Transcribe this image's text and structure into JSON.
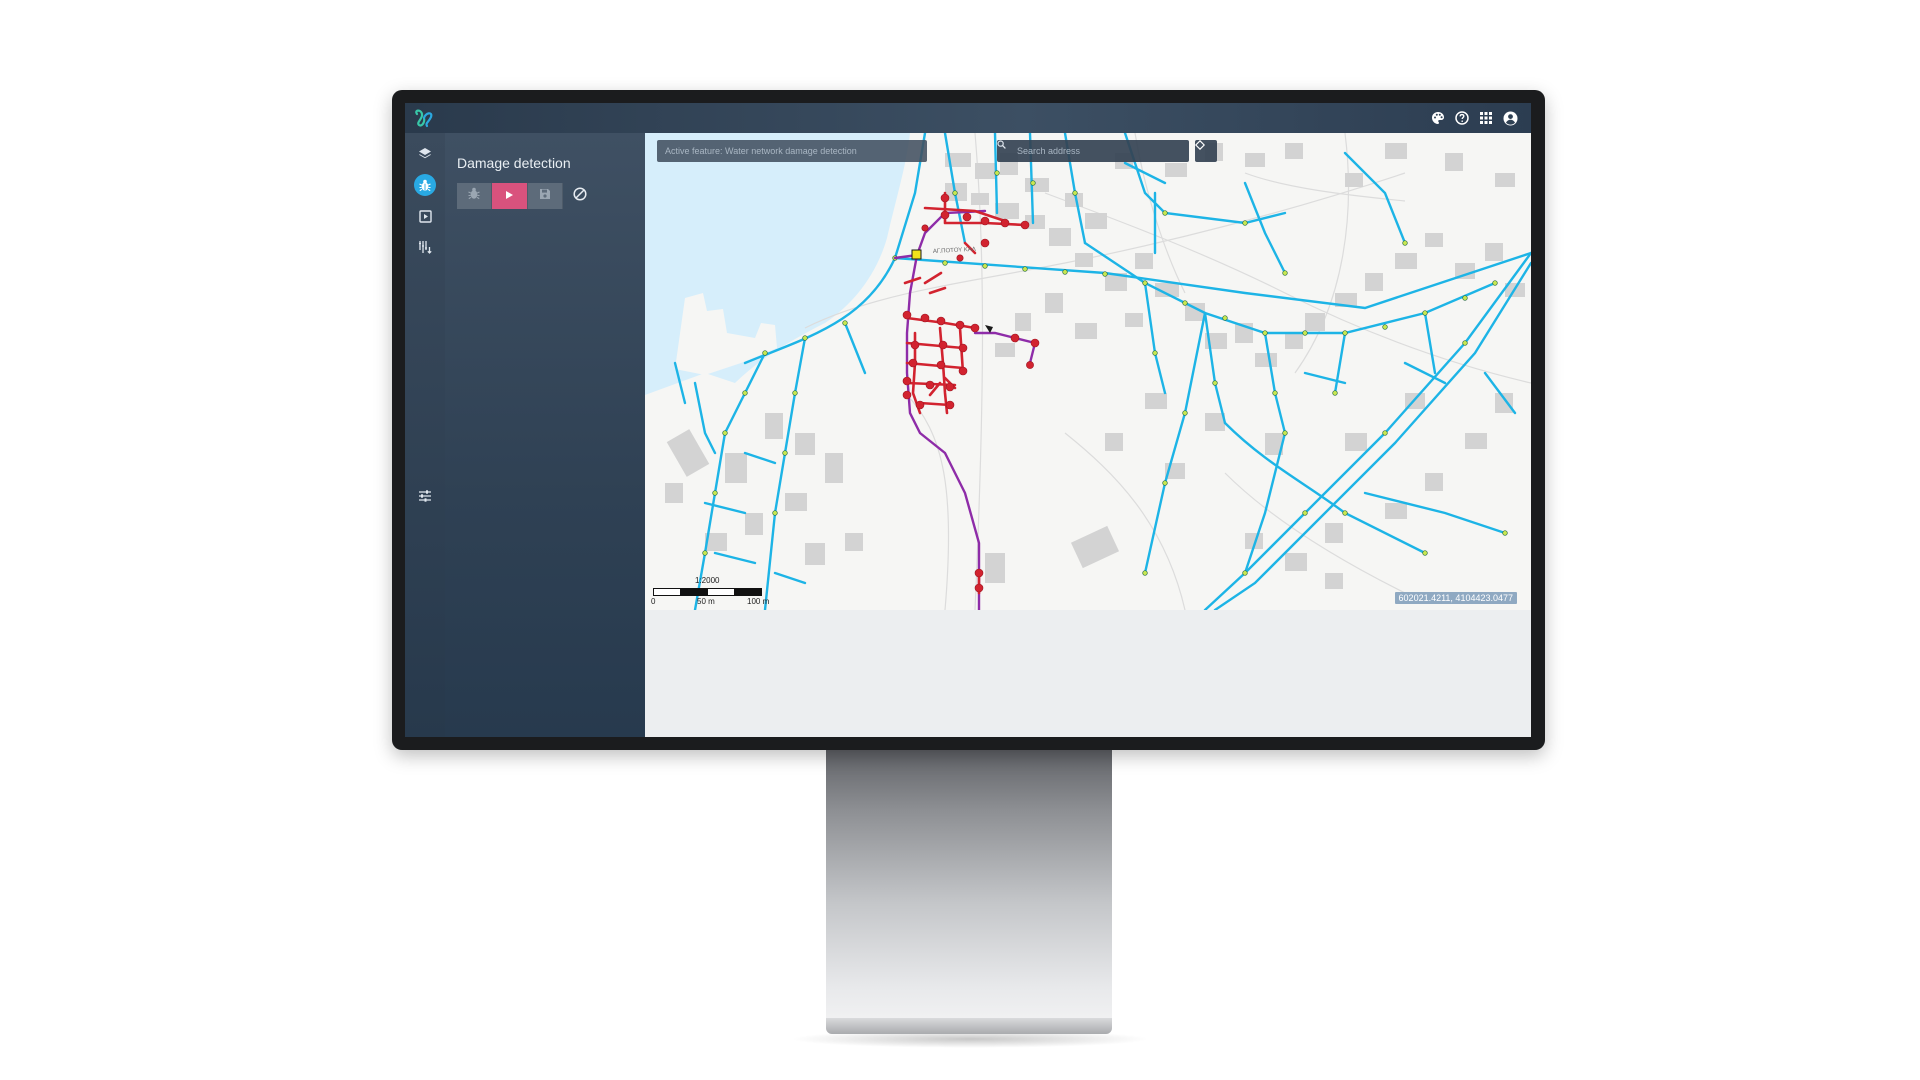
{
  "panel": {
    "title": "Damage detection",
    "toolbar": {
      "detect_icon": "bug-icon",
      "run_icon": "play-icon",
      "save_icon": "save-icon",
      "cancel_icon": "cancel-icon"
    }
  },
  "topbar": {
    "icons": [
      "palette-icon",
      "help-icon",
      "apps-grid-icon",
      "account-icon"
    ]
  },
  "rail": {
    "items": [
      "layers-icon",
      "bug-icon",
      "play-box-icon",
      "filter-sort-icon",
      "tune-icon"
    ],
    "active": "bug-icon"
  },
  "map": {
    "active_feature": "Active feature: Water network damage detection",
    "search_placeholder": "Search address",
    "coordinates": "602021.4211, 4104423.0477",
    "street_label": "ΑΓ.ΠΟΤΟΥ ΚΑΛ",
    "scale": {
      "ratio": "1:2000",
      "labels": [
        "0",
        "50 m",
        "100 m"
      ]
    }
  },
  "colors": {
    "pipe": "#1db4e6",
    "damage": "#d2232f",
    "route": "#8e2ca8",
    "accent": "#29a9e3",
    "run_button": "#d9527d"
  }
}
